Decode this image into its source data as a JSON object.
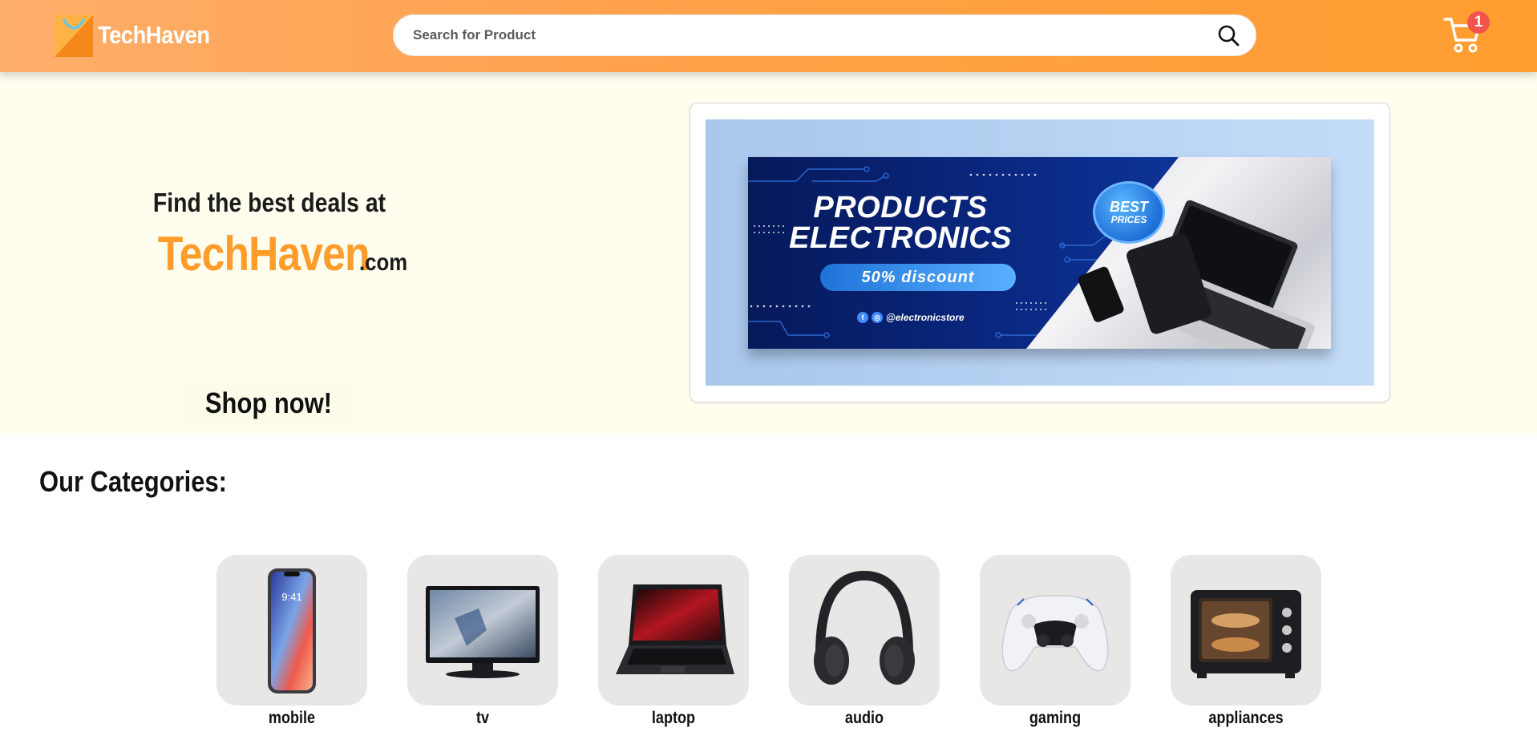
{
  "header": {
    "brand": "TechHaven",
    "search_placeholder": "Search for Product",
    "cart_count": "1",
    "colors": {
      "accent": "#ff9c2a",
      "badge": "#f2544c"
    }
  },
  "hero": {
    "tagline": "Find the best deals at",
    "brand": "TechHaven",
    "domain": ".com",
    "cta": "Shop now!",
    "banner": {
      "title_line1": "PRODUCTS",
      "title_line2": "ELECTRONICS",
      "discount": "50% discount",
      "badge_line1": "BEST",
      "badge_line2": "PRICES",
      "handle": "@electronicstore"
    }
  },
  "categories": {
    "title": "Our Categories:",
    "items": [
      {
        "label": "mobile",
        "icon": "smartphone"
      },
      {
        "label": "tv",
        "icon": "television"
      },
      {
        "label": "laptop",
        "icon": "laptop"
      },
      {
        "label": "audio",
        "icon": "headphones"
      },
      {
        "label": "gaming",
        "icon": "game-controller"
      },
      {
        "label": "appliances",
        "icon": "toaster-oven"
      }
    ]
  }
}
